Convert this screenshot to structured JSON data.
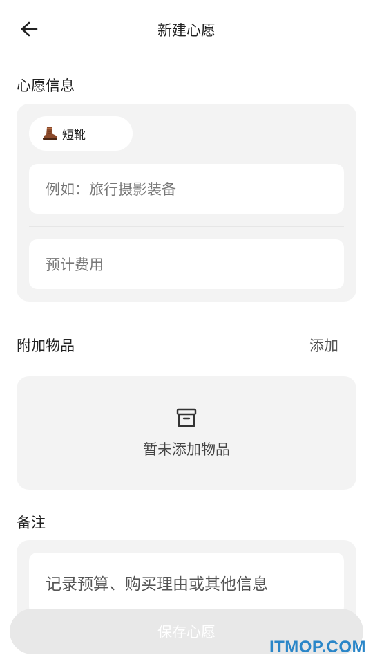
{
  "header": {
    "title": "新建心愿",
    "back_icon": "arrow-left-icon"
  },
  "wish_info": {
    "section_label": "心愿信息",
    "emoji_chip": {
      "icon": "boot-icon",
      "label": "短靴"
    },
    "name_placeholder": "例如：旅行摄影装备",
    "cost_placeholder": "预计费用"
  },
  "items": {
    "section_label": "附加物品",
    "add_label": "添加",
    "empty_icon": "archive-box-icon",
    "empty_text": "暂未添加物品"
  },
  "note": {
    "section_label": "备注",
    "placeholder": "记录预算、购买理由或其他信息"
  },
  "save_button": {
    "label": "保存心愿"
  },
  "watermark": "ITMOP.COM"
}
